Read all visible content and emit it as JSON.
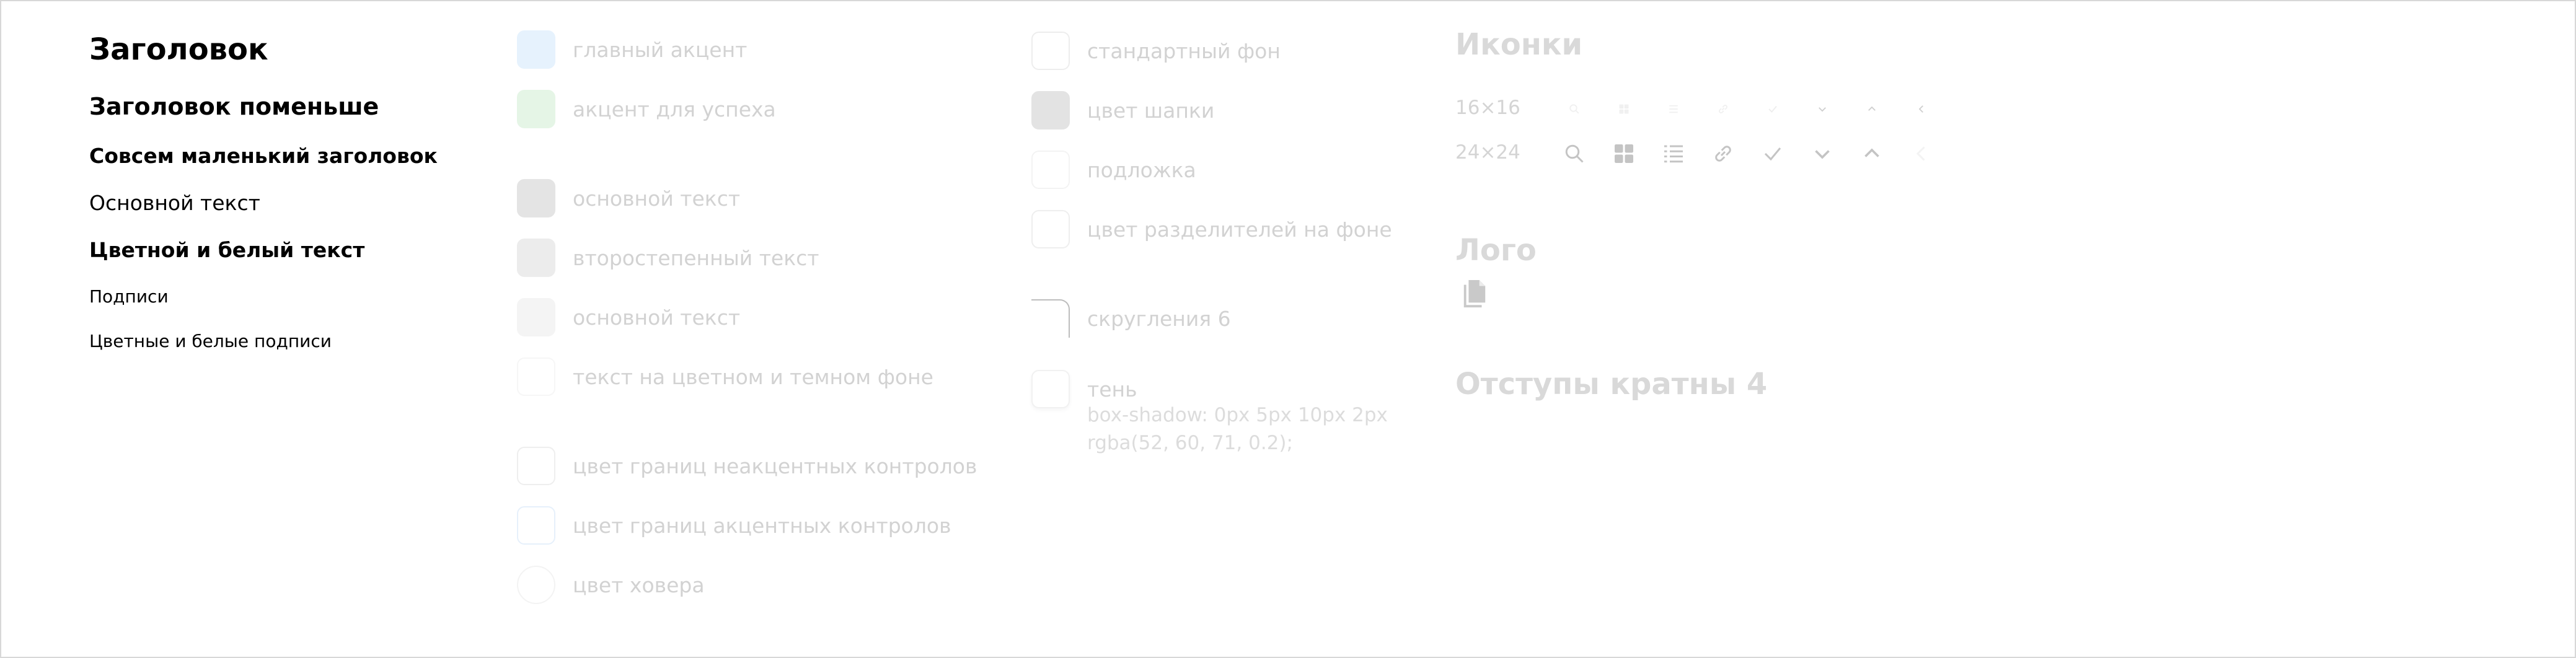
{
  "typography": {
    "heading": "Заголовок",
    "heading_smaller": "Заголовок поменьше",
    "heading_tiny": "Совсем маленький заголовок",
    "body_text": "Основной текст",
    "colored_white_text": "Цветной и белый текст",
    "captions": "Подписи",
    "colored_white_captions": "Цветные и белые подписи"
  },
  "colors_primary": [
    {
      "label": "главный акцент",
      "fill": "#e6f2fd",
      "border": "#e6f2fd"
    },
    {
      "label": "акцент для успеха",
      "fill": "#e5f5e6",
      "border": "#e5f5e6"
    },
    {
      "label": "основной текст",
      "fill": "#e4e4e4",
      "border": "#e4e4e4"
    },
    {
      "label": "второстепенный текст",
      "fill": "#ececec",
      "border": "#ececec"
    },
    {
      "label": "основной текст",
      "fill": "#f4f4f4",
      "border": "#f4f4f4"
    },
    {
      "label": "текст на цветном и темном фоне",
      "fill": "#ffffff",
      "border": "#f6f6f6"
    },
    {
      "label": "цвет границ неакцентных контролов",
      "fill": "#ffffff",
      "border": "#eeeeee"
    },
    {
      "label": "цвет границ акцентных контролов",
      "fill": "#ffffff",
      "border": "#e6f0fb"
    },
    {
      "label": "цвет ховера",
      "fill": "#ffffff",
      "border": "#f3f3f3"
    }
  ],
  "colors_surfaces": [
    {
      "label": "стандартный фон",
      "fill": "#ffffff",
      "border": "#ededed"
    },
    {
      "label": "цвет шапки",
      "fill": "#e3e3e3",
      "border": "#e3e3e3"
    },
    {
      "label": "подложка",
      "fill": "#ffffff",
      "border": "#f3f3f3"
    },
    {
      "label": "цвет разделителей на фоне",
      "fill": "#ffffff",
      "border": "#eeeeee"
    }
  ],
  "radius": {
    "label": "скругления 6"
  },
  "shadow": {
    "label": "тень",
    "desc_line1": "box-shadow: 0px 5px 10px 2px",
    "desc_line2": "rgba(52, 60, 71, 0.2);"
  },
  "icons": {
    "title": "Иконки",
    "size_small": "16×16",
    "size_large": "24×24",
    "small_names": [
      "search-icon",
      "grid-icon",
      "list-icon",
      "link-icon",
      "check-icon",
      "chevron-down-icon",
      "chevron-up-icon",
      "chevron-left-icon"
    ],
    "large_names": [
      "search-icon",
      "grid-icon",
      "list-icon",
      "link-icon",
      "check-icon",
      "chevron-down-icon",
      "chevron-up-icon",
      "chevron-left-icon"
    ],
    "color": "#c4c4c4"
  },
  "logo": {
    "title": "Лого",
    "icon": "document-icon"
  },
  "spacing": {
    "title": "Отступы кратны 4"
  }
}
